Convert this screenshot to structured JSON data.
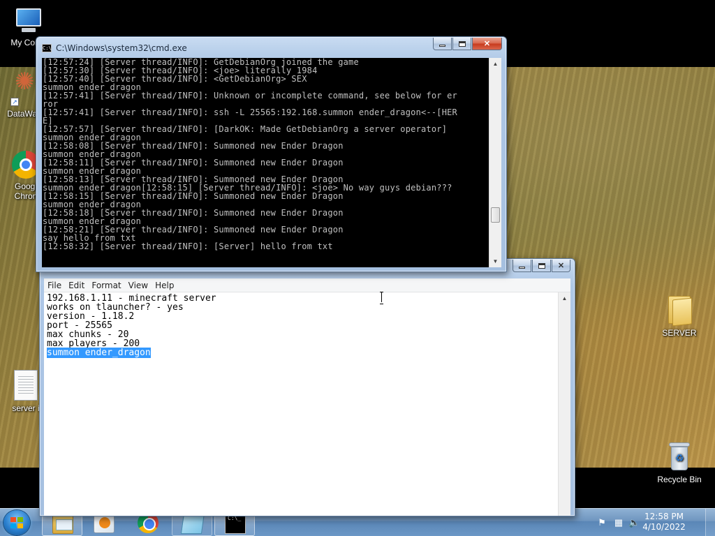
{
  "desktop": {
    "icons": {
      "computer": "My Comp",
      "datawagon": "DataWag",
      "chrome_line1": "Googl",
      "chrome_line2": "Chron",
      "server_file": "server i",
      "server_folder": "SERVER",
      "recycle_bin": "Recycle Bin"
    }
  },
  "cmd_window": {
    "title": "C:\\Windows\\system32\\cmd.exe",
    "lines": [
      "[12:57:24] [Server thread/INFO]: GetDebianOrg joined the game",
      "[12:57:30] [Server thread/INFO]: <joe> literally 1984",
      "[12:57:40] [Server thread/INFO]: <GetDebianOrg> SEX",
      "summon ender_dragon",
      "[12:57:41] [Server thread/INFO]: Unknown or incomplete command, see below for er",
      "ror",
      "[12:57:41] [Server thread/INFO]: ssh -L 25565:192.168.summon ender_dragon<--[HER",
      "E]",
      "[12:57:57] [Server thread/INFO]: [DarkOK: Made GetDebianOrg a server operator]",
      "summon ender_dragon",
      "[12:58:08] [Server thread/INFO]: Summoned new Ender Dragon",
      "summon ender_dragon",
      "[12:58:11] [Server thread/INFO]: Summoned new Ender Dragon",
      "summon ender_dragon",
      "[12:58:13] [Server thread/INFO]: Summoned new Ender Dragon",
      "summon ender_dragon[12:58:15] [Server thread/INFO]: <joe> No way guys debian???",
      "",
      "[12:58:15] [Server thread/INFO]: Summoned new Ender Dragon",
      "summon ender_dragon",
      "[12:58:18] [Server thread/INFO]: Summoned new Ender Dragon",
      "summon ender_dragon",
      "[12:58:21] [Server thread/INFO]: Summoned new Ender Dragon",
      "say hello from txt",
      "[12:58:32] [Server thread/INFO]: [Server] hello from txt"
    ]
  },
  "notepad": {
    "menu": [
      "File",
      "Edit",
      "Format",
      "View",
      "Help"
    ],
    "lines": [
      "192.168.1.11 - minecraft server",
      "works on tlauncher? - yes",
      "version - 1.18.2",
      "port - 25565",
      "max chunks - 20",
      "max players - 200"
    ],
    "selected_line": "summon ender_dragon"
  },
  "taskbar": {
    "clock_time": "12:58 PM",
    "clock_date": "4/10/2022",
    "cmd_glyph": "C:\\_"
  }
}
